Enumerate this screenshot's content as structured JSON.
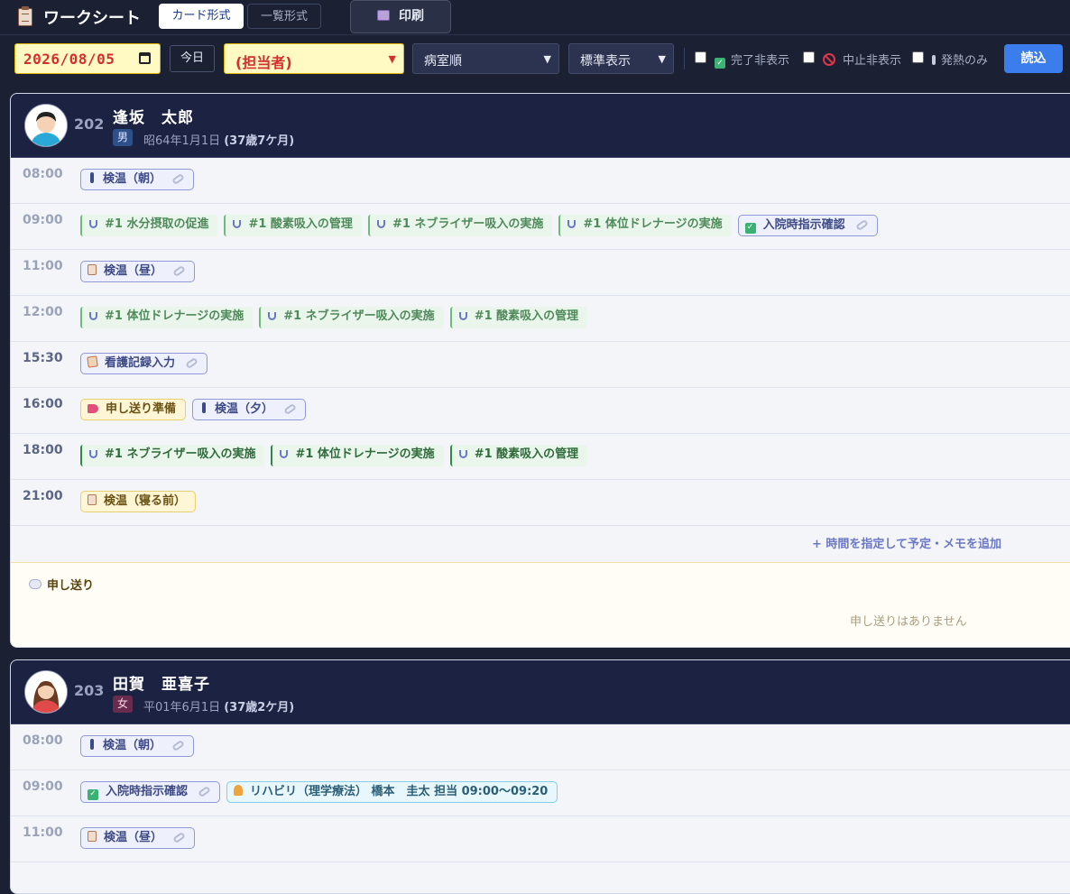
{
  "app": {
    "title": "ワークシート"
  },
  "view_tabs": [
    {
      "label": "カード形式",
      "active": true
    },
    {
      "label": "一覧形式",
      "active": false
    }
  ],
  "print": {
    "label": "印刷"
  },
  "filters": {
    "date": "2026/08/05",
    "today_label": "今日",
    "staff": "(担当者)",
    "sort": "病室順",
    "display": "標準表示",
    "hide_done": "完了非表示",
    "hide_cancelled": "中止非表示",
    "fever_only": "発熱のみ",
    "load_label": "読込"
  },
  "patients": [
    {
      "room": "202",
      "name": "逢坂　太郎",
      "sex": "男",
      "dob": "昭64年1月1日",
      "age": "(37歳7ケ月)",
      "slots": [
        {
          "time": "08:00",
          "items": [
            {
              "label": "検温（朝）",
              "kind": "task",
              "icon": "thermometer-icon"
            }
          ]
        },
        {
          "time": "09:00",
          "items": [
            {
              "label": "#1 水分摂取の促進",
              "kind": "plan",
              "icon": "stethoscope-icon"
            },
            {
              "label": "#1 酸素吸入の管理",
              "kind": "plan",
              "icon": "stethoscope-icon"
            },
            {
              "label": "#1 ネブライザー吸入の実施",
              "kind": "plan",
              "icon": "stethoscope-icon"
            },
            {
              "label": "#1 体位ドレナージの実施",
              "kind": "plan",
              "icon": "stethoscope-icon"
            },
            {
              "label": "入院時指示確認",
              "kind": "task",
              "icon": "checkbox-icon"
            }
          ]
        },
        {
          "time": "11:00",
          "items": [
            {
              "label": "検温（昼）",
              "kind": "task",
              "icon": "clipboard-icon"
            }
          ]
        },
        {
          "time": "12:00",
          "items": [
            {
              "label": "#1 体位ドレナージの実施",
              "kind": "plan",
              "icon": "stethoscope-icon"
            },
            {
              "label": "#1 ネブライザー吸入の実施",
              "kind": "plan",
              "icon": "stethoscope-icon"
            },
            {
              "label": "#1 酸素吸入の管理",
              "kind": "plan",
              "icon": "stethoscope-icon"
            }
          ]
        },
        {
          "time": "15:30",
          "items": [
            {
              "label": "看護記録入力",
              "kind": "task",
              "icon": "memo-icon"
            }
          ]
        },
        {
          "time": "16:00",
          "items": [
            {
              "label": "申し送り準備",
              "kind": "yellow",
              "icon": "megaphone-icon"
            },
            {
              "label": "検温（夕）",
              "kind": "task",
              "icon": "thermometer-icon"
            }
          ]
        },
        {
          "time": "18:00",
          "items": [
            {
              "label": "#1 ネブライザー吸入の実施",
              "kind": "plan",
              "icon": "stethoscope-icon"
            },
            {
              "label": "#1 体位ドレナージの実施",
              "kind": "plan",
              "icon": "stethoscope-icon"
            },
            {
              "label": "#1 酸素吸入の管理",
              "kind": "plan",
              "icon": "stethoscope-icon"
            }
          ]
        },
        {
          "time": "21:00",
          "items": [
            {
              "label": "検温（寝る前）",
              "kind": "yellow",
              "icon": "clipboard-icon"
            }
          ]
        }
      ],
      "add_label": "+ 時間を指定して予定・メモを追加",
      "handover_title": "申し送り",
      "handover_empty": "申し送りはありません"
    },
    {
      "room": "203",
      "name": "田賀　亜喜子",
      "sex": "女",
      "dob": "平01年6月1日",
      "age": "(37歳2ケ月)",
      "slots": [
        {
          "time": "08:00",
          "items": [
            {
              "label": "検温（朝）",
              "kind": "task",
              "icon": "thermometer-icon"
            }
          ]
        },
        {
          "time": "09:00",
          "items": [
            {
              "label": "入院時指示確認",
              "kind": "task",
              "icon": "checkbox-icon"
            },
            {
              "label": "リハビリ（理学療法） 橋本　圭太 担当 09:00〜09:20",
              "kind": "cyan",
              "icon": "runner-icon"
            }
          ]
        },
        {
          "time": "11:00",
          "items": [
            {
              "label": "検温（昼）",
              "kind": "task",
              "icon": "clipboard-icon"
            }
          ]
        }
      ]
    }
  ]
}
